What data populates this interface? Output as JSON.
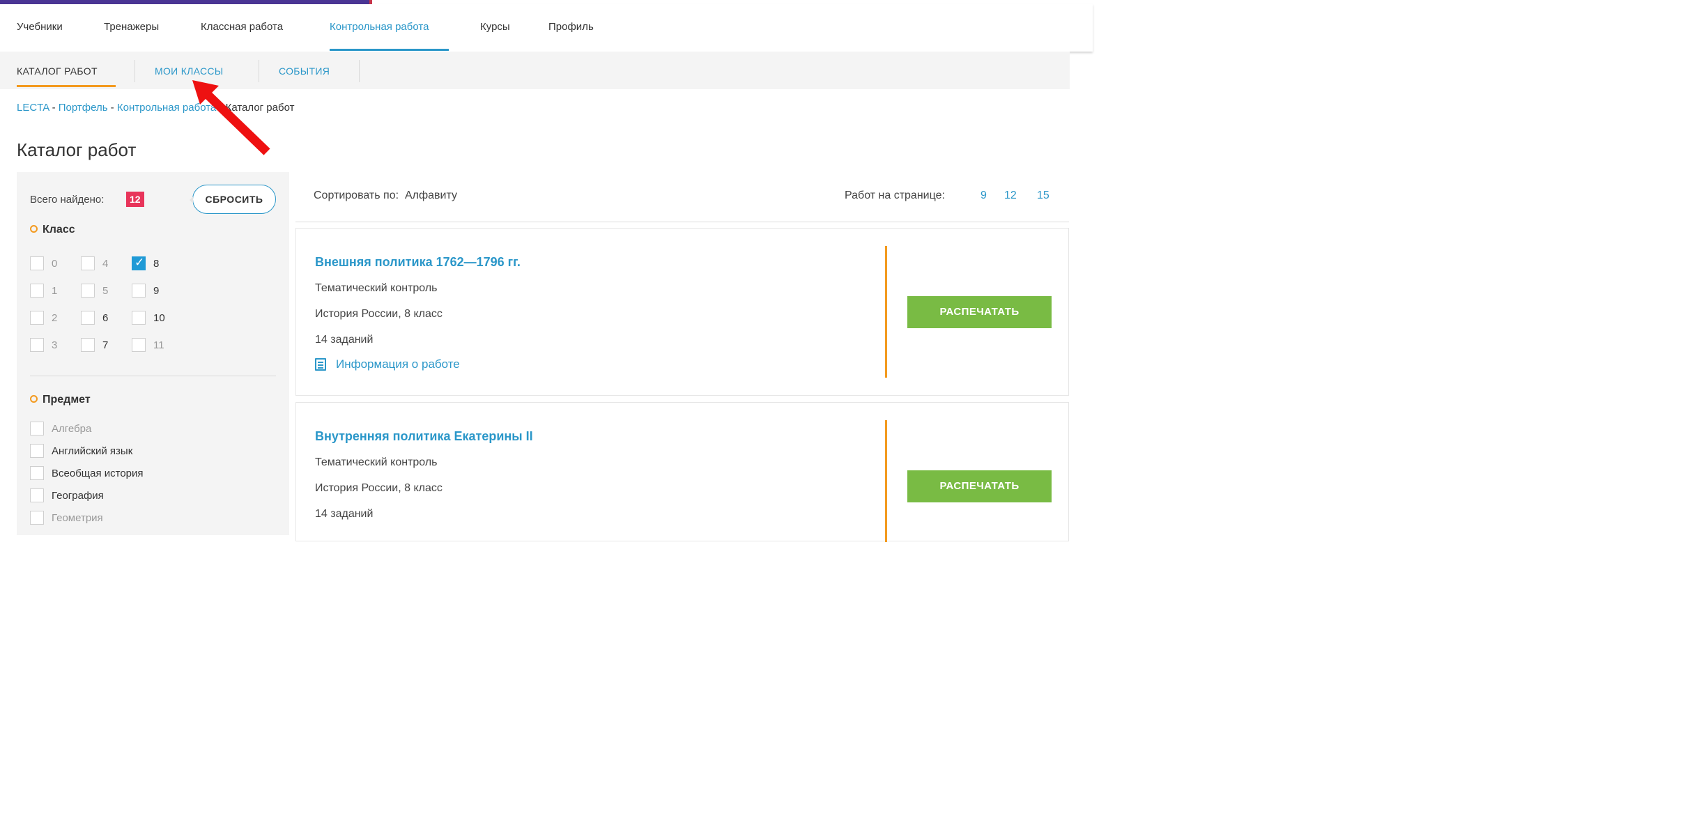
{
  "main_nav": {
    "items": [
      "Учебники",
      "Тренажеры",
      "Классная работа",
      "Контрольная работа",
      "Курсы",
      "Профиль"
    ],
    "active_index": 3
  },
  "sub_nav": {
    "tabs": [
      "КАТАЛОГ РАБОТ",
      "МОИ КЛАССЫ",
      "СОБЫТИЯ"
    ],
    "active_index": 0
  },
  "breadcrumb": {
    "links": [
      "LECTA",
      "Портфель",
      "Контрольная работа"
    ],
    "separator": " - ",
    "current": "Каталог работ"
  },
  "page_title": "Каталог работ",
  "filters": {
    "found_label": "Всего найдено:",
    "found_count": "12",
    "reset_label": "СБРОСИТЬ",
    "class_section": {
      "title": "Класс",
      "options": [
        {
          "label": "0",
          "checked": false,
          "dim": true
        },
        {
          "label": "4",
          "checked": false,
          "dim": true
        },
        {
          "label": "8",
          "checked": true,
          "dim": false
        },
        {
          "label": "1",
          "checked": false,
          "dim": true
        },
        {
          "label": "5",
          "checked": false,
          "dim": true
        },
        {
          "label": "9",
          "checked": false,
          "dim": false
        },
        {
          "label": "2",
          "checked": false,
          "dim": true
        },
        {
          "label": "6",
          "checked": false,
          "dim": false
        },
        {
          "label": "10",
          "checked": false,
          "dim": false
        },
        {
          "label": "3",
          "checked": false,
          "dim": true
        },
        {
          "label": "7",
          "checked": false,
          "dim": false
        },
        {
          "label": "11",
          "checked": false,
          "dim": true
        }
      ]
    },
    "subject_section": {
      "title": "Предмет",
      "options": [
        {
          "label": "Алгебра",
          "checked": false,
          "dim": true
        },
        {
          "label": "Английский язык",
          "checked": false,
          "dim": false
        },
        {
          "label": "Всеобщая история",
          "checked": false,
          "dim": false
        },
        {
          "label": "География",
          "checked": false,
          "dim": false
        },
        {
          "label": "Геометрия",
          "checked": false,
          "dim": true
        }
      ]
    }
  },
  "sort": {
    "label": "Сортировать по:",
    "value": "Алфавиту",
    "per_page_label": "Работ на странице:",
    "per_page_options": [
      "9",
      "12",
      "15"
    ]
  },
  "works": [
    {
      "title": "Внешняя политика 1762—1796 гг.",
      "type": "Тематический контроль",
      "course": "История России, 8 класс",
      "tasks": "14 заданий",
      "info_label": "Информация о работе",
      "print_label": "РАСПЕЧАТАТЬ"
    },
    {
      "title": "Внутренняя политика Екатерины II",
      "type": "Тематический контроль",
      "course": "История России, 8 класс",
      "tasks": "14 заданий",
      "info_label": "Информация о работе",
      "print_label": "РАСПЕЧАТАТЬ"
    }
  ],
  "colors": {
    "accent_blue": "#2b97c9",
    "accent_orange": "#f39a1f",
    "print_green": "#79bb44",
    "badge_pink": "#e8345a",
    "annotation_arrow": "#ee1111"
  }
}
